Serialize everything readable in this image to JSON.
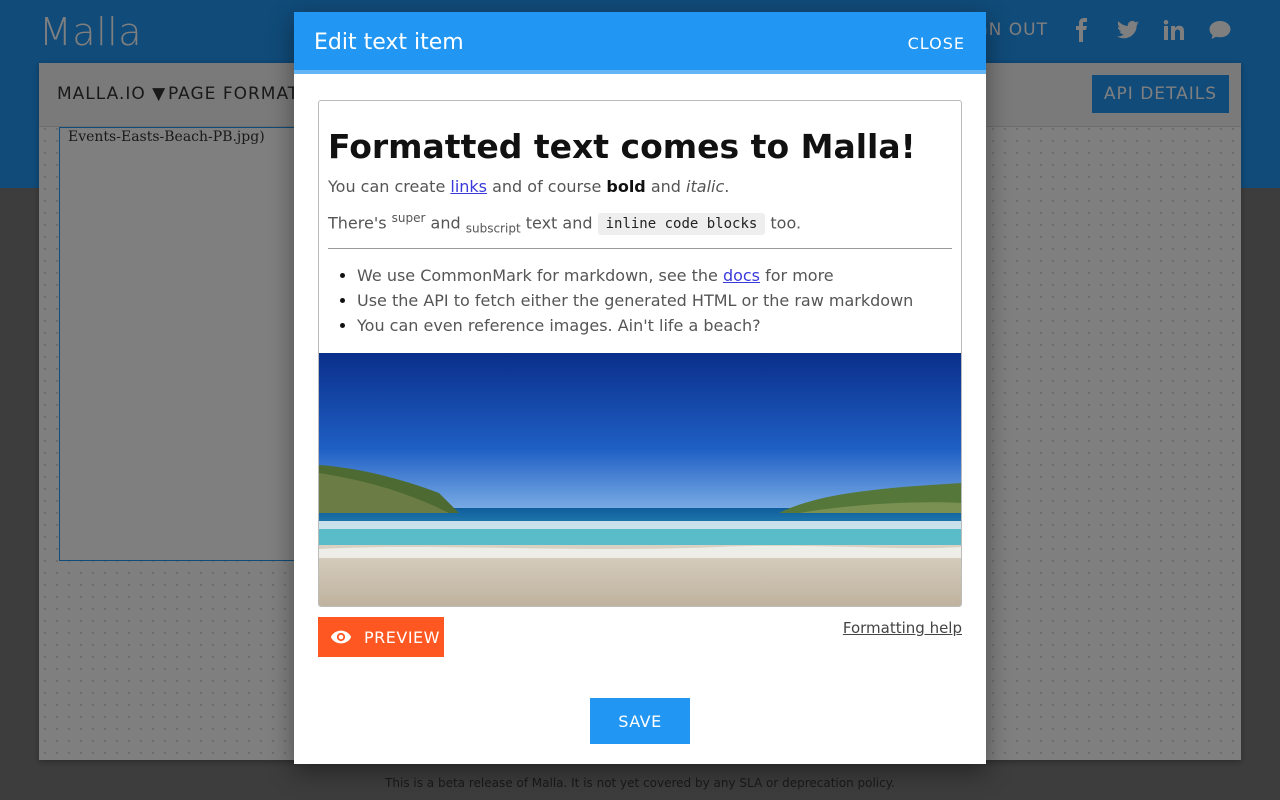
{
  "app": {
    "title": "Malla",
    "sign_out": "SIGN OUT",
    "social_icons": [
      "facebook-icon",
      "twitter-icon",
      "linkedin-icon",
      "chat-icon"
    ]
  },
  "toolbar": {
    "menu_malla": "MALLA.IO ▼",
    "menu_page_format": "PAGE FORMAT ▼",
    "api_details": "API DETAILS"
  },
  "canvas": {
    "item_text": "Events-Easts-Beach-PB.jpg)"
  },
  "footer_note": "This is a beta release of Malla. It is not yet covered by any SLA or deprecation policy.",
  "modal": {
    "title": "Edit text item",
    "close": "CLOSE",
    "preview": {
      "heading": "Formatted text comes to Malla!",
      "p1_a": "You can create ",
      "p1_link": "links",
      "p1_b": " and of course ",
      "p1_bold": "bold",
      "p1_c": " and ",
      "p1_italic": "italic",
      "p1_d": ".",
      "p2_a": "There's ",
      "p2_sup": "super",
      "p2_b": " and ",
      "p2_sub": "subscript",
      "p2_c": " text and ",
      "p2_code": "inline code blocks",
      "p2_d": " too.",
      "list": {
        "item1_a": "We use CommonMark for markdown, see the ",
        "item1_link": "docs",
        "item1_b": " for more",
        "item2": "Use the API to fetch either the generated HTML or the raw markdown",
        "item3": "You can even reference images. Ain't life a beach?"
      }
    },
    "preview_button": "PREVIEW",
    "formatting_help": "Formatting help",
    "save": "SAVE"
  },
  "colors": {
    "primary": "#2196f3",
    "accent": "#ff5722"
  }
}
